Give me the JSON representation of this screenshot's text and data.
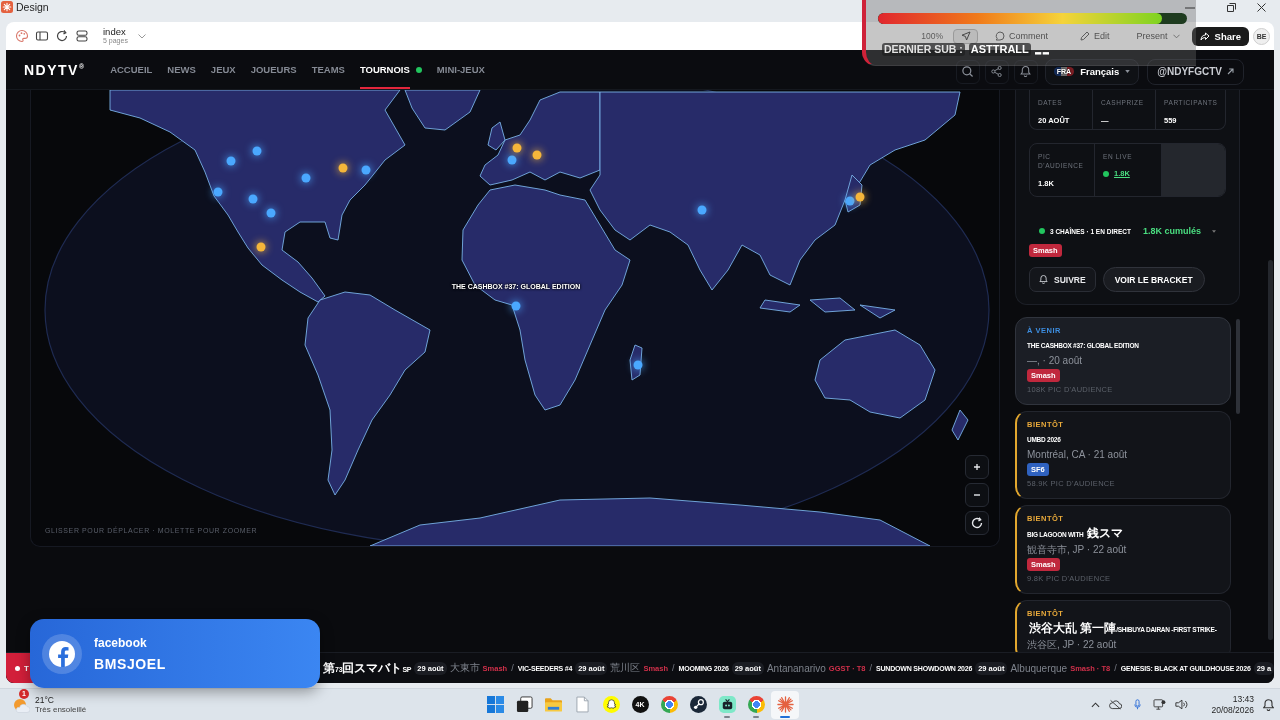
{
  "window": {
    "title": "Design"
  },
  "toolbar": {
    "page": "index",
    "pages": "5 pages",
    "zoom": "100%",
    "tools": [
      {
        "kind": "pointer",
        "selected": true
      },
      {
        "kind": "comment",
        "label": "Comment",
        "selected": false
      },
      {
        "kind": "edit",
        "label": "Edit",
        "selected": false
      }
    ],
    "present": "Present",
    "share": "Share",
    "avatar": "BE"
  },
  "overlay": {
    "level": 0.92,
    "label": "DERNIER SUB :",
    "value": "ASTTRALL"
  },
  "nav": {
    "logo": "NDYTV$^{®}$",
    "items": [
      {
        "label": "ACCUEIL",
        "selected": false,
        "live": false
      },
      {
        "label": "NEWS",
        "selected": false,
        "live": false
      },
      {
        "label": "JEUX",
        "selected": false,
        "live": false
      },
      {
        "label": "JOUEURS",
        "selected": false,
        "live": false
      },
      {
        "label": "TEAMS",
        "selected": false,
        "live": false
      },
      {
        "label": "TOURNOIS",
        "selected": true,
        "live": true
      },
      {
        "label": "MINI-JEUX",
        "selected": false,
        "live": false
      }
    ],
    "language": {
      "code": "FRA",
      "label": "Français"
    },
    "handle": "@NDYFGCTV"
  },
  "map": {
    "label": "THE CASHBOX #37: GLOBAL EDITION",
    "hint": "GLISSER POUR DÉPLACER · MOLETTE POUR ZOOMER",
    "markers": [
      {
        "color": "#4aa8ff"
      },
      {
        "color": "#4aa8ff"
      },
      {
        "color": "#4aa8ff"
      },
      {
        "color": "#4aa8ff"
      },
      {
        "color": "#f5b63a"
      },
      {
        "color": "#4aa8ff"
      },
      {
        "color": "#4aa8ff"
      },
      {
        "color": "#f5b63a"
      },
      {
        "color": "#4aa8ff"
      },
      {
        "color": "#4aa8ff"
      },
      {
        "color": "#f5b63a"
      },
      {
        "color": "#f5b63a"
      },
      {
        "color": "#4aa8ff"
      },
      {
        "color": "#4aa8ff"
      },
      {
        "color": "#4aa8ff"
      },
      {
        "color": "#4aa8ff"
      },
      {
        "color": "#f5b63a"
      }
    ]
  },
  "event": {
    "stats": [
      {
        "label": "DATES",
        "value": "20 AOÛT"
      },
      {
        "label": "CASHPRIZE",
        "value": "—"
      },
      {
        "label": "PARTICIPANTS",
        "value": "559"
      }
    ],
    "audience": [
      {
        "label": "PIC D'AUDIENCE",
        "value": "1.8K",
        "live": false
      },
      {
        "label": "EN LIVE",
        "value": "1.8K",
        "live": true
      }
    ],
    "channels": {
      "label": "3 CHAÎNES · 1 EN DIRECT",
      "live": true
    },
    "cumulative": "1.8K cumulés",
    "tag": {
      "label": "Smash",
      "color": "#c0283d"
    },
    "follow": "SUIVRE",
    "bracket": "VOIR LE BRACKET"
  },
  "events": [
    {
      "kind": "upcoming",
      "status": "À VENIR",
      "title": "THE CASHBOX #37: GLOBAL EDITION",
      "meta": "—, · 20 août",
      "tag": {
        "label": "Smash",
        "color": "#c0283d"
      },
      "audience": "108K PIC D'AUDIENCE",
      "selected": true
    },
    {
      "kind": "soon",
      "status": "BIENTÔT",
      "title": "UMBD 2026",
      "meta": "Montréal, CA · 21 août",
      "tag": {
        "label": "SF6",
        "color": "#2f62c0"
      },
      "audience": "58.9K PIC D'AUDIENCE",
      "selected": false
    },
    {
      "kind": "soon",
      "status": "BIENTÔT",
      "title": "BIG LAGOON WITH **銭スマ**",
      "meta": "観音寺市, JP · 22 août",
      "tag": {
        "label": "Smash",
        "color": "#c0283d"
      },
      "audience": "9.8K PIC D'AUDIENCE",
      "selected": false
    },
    {
      "kind": "soon",
      "status": "BIENTÔT",
      "title": "**渋谷大乱 第一陣**/SHIBUYA DAIRAN -FIRST STRIKE-",
      "meta": "渋谷区, JP · 22 août",
      "selected": false
    }
  ],
  "ticker": {
    "label": "T",
    "items": [
      {
        "title": "**第**73**回スマバト**SP",
        "date": "29 août",
        "city": "大東市",
        "tags": "Smash",
        "separator": "/"
      },
      {
        "title": "VIC-SEEDERS #4",
        "date": "29 août",
        "city": "荒川区",
        "tags": "Smash",
        "separator": "/"
      },
      {
        "title": "MOOMING 2026",
        "date": "29 août",
        "city": "Antananarivo",
        "tags": "GGST · T8",
        "separator": "/"
      },
      {
        "title": "SUNDOWN SHOWDOWN 2026",
        "date": "29 août",
        "city": "Albuquerque",
        "tags": "Smash · T8",
        "separator": "/"
      },
      {
        "title": "GENESIS: BLACK AT GUILDHOUSE 2026",
        "date": "29 a"
      }
    ]
  },
  "toast": {
    "app": "facebook",
    "user": "BMSJOEL"
  },
  "taskbar": {
    "weather": {
      "badge": "1",
      "temperature": "21°C",
      "condition": "Très ensoleillé"
    },
    "apps": [
      {
        "kind": "start",
        "running": false,
        "active": false
      },
      {
        "kind": "taskview",
        "running": false,
        "active": false
      },
      {
        "kind": "folder",
        "running": false,
        "active": false
      },
      {
        "kind": "file",
        "running": false,
        "active": false
      },
      {
        "kind": "ghost",
        "running": false,
        "active": false
      },
      {
        "kind": "label",
        "label": "4K",
        "running": false,
        "active": false
      },
      {
        "kind": "ring",
        "running": false,
        "active": false
      },
      {
        "kind": "round",
        "running": false,
        "active": false
      },
      {
        "kind": "tv",
        "running": true,
        "active": false
      },
      {
        "kind": "ring",
        "running": true,
        "active": false
      },
      {
        "kind": "asterisk",
        "running": true,
        "active": true
      }
    ],
    "time": "13:43",
    "date": "20/08/2026"
  }
}
